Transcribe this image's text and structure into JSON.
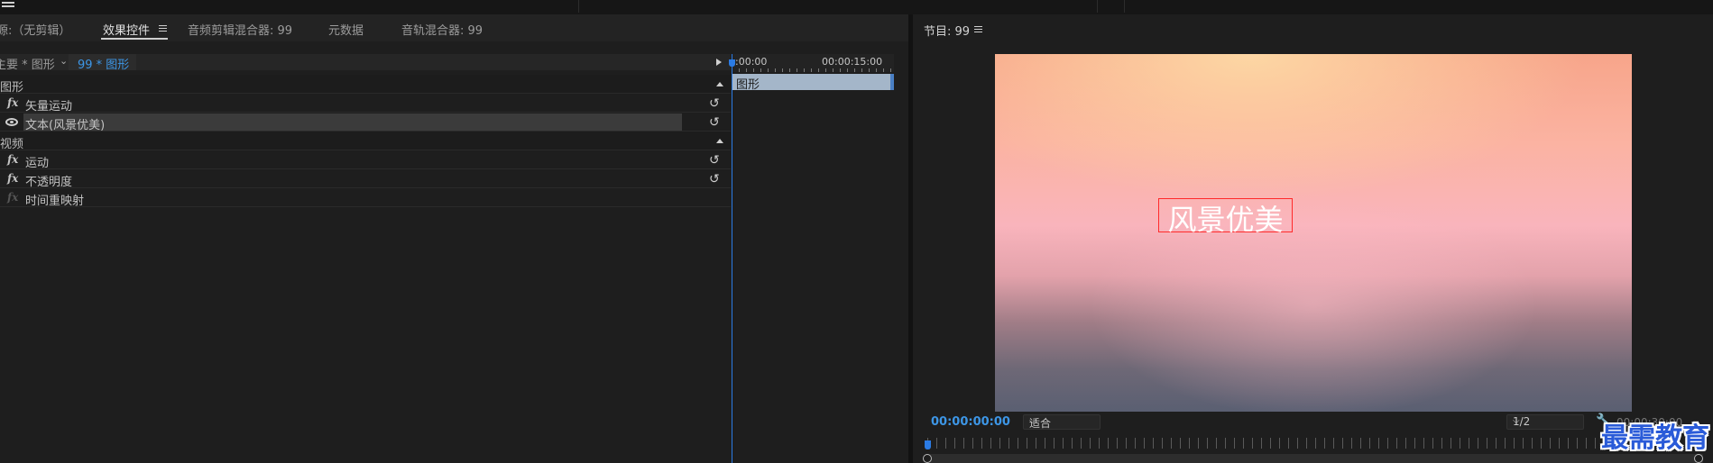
{
  "tabs": [
    {
      "label": "源:（无剪辑）"
    },
    {
      "label": "效果控件",
      "active": true
    },
    {
      "label": "音频剪辑混合器: 99"
    },
    {
      "label": "元数据"
    },
    {
      "label": "音轨混合器: 99"
    }
  ],
  "effect_controls": {
    "breadcrumb_source": "主要 * 图形",
    "breadcrumb_sequence": "99 * 图形",
    "rows": [
      {
        "label": "图形"
      },
      {
        "label": "矢量运动"
      },
      {
        "label": "文本(风景优美)"
      },
      {
        "label": "视频"
      },
      {
        "label": "运动"
      },
      {
        "label": "不透明度"
      },
      {
        "label": "时间重映射"
      }
    ],
    "fx_symbol": "fx",
    "reset_symbol": "↺",
    "timeline_start": ":00:00",
    "timeline_mid": "00:00:15:00",
    "clip_label": "图形"
  },
  "program": {
    "title": "节目: 99",
    "title_text": "风景优美",
    "timecode": "00:00:00:00",
    "zoom": "适合",
    "resolution": "1/2",
    "duration": "00:00:30:00"
  },
  "watermark": "最需教育",
  "colors": {
    "accent_blue": "#3d96e6",
    "title_box": "#ff2a2a",
    "clip": "#a4b6c9"
  }
}
